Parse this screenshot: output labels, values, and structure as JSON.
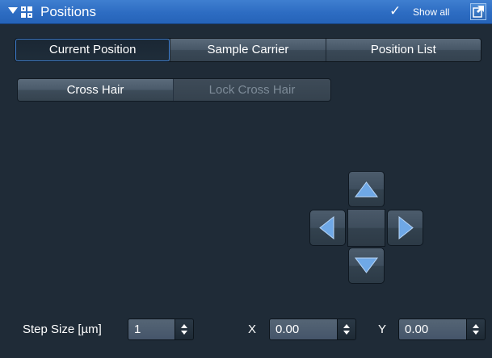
{
  "panel": {
    "title": "Positions",
    "title_icon": "positions-grid-icon",
    "collapse_icon": "collapse-triangle-icon",
    "show_all": {
      "check_glyph": "✓",
      "label": "Show all",
      "checked": true
    },
    "undock_icon": "undock-icon"
  },
  "tabs": [
    {
      "label": "Current Position",
      "active": true
    },
    {
      "label": "Sample Carrier",
      "active": false
    },
    {
      "label": "Position List",
      "active": false
    }
  ],
  "crosshair": {
    "cross_hair_label": "Cross Hair",
    "lock_label": "Lock Cross Hair",
    "lock_enabled": false
  },
  "dpad": {
    "up_icon": "arrow-up-icon",
    "down_icon": "arrow-down-icon",
    "left_icon": "arrow-left-icon",
    "right_icon": "arrow-right-icon"
  },
  "step": {
    "label": "Step Size [µm]",
    "value": "1"
  },
  "x": {
    "label": "X",
    "value": "0.00"
  },
  "y": {
    "label": "Y",
    "value": "0.00"
  },
  "colors": {
    "background": "#1f2b37",
    "title_bar": "#2d6cc2",
    "arrow_fill": "#6fa8e6",
    "active_tab_outline": "#3f7fd0"
  }
}
